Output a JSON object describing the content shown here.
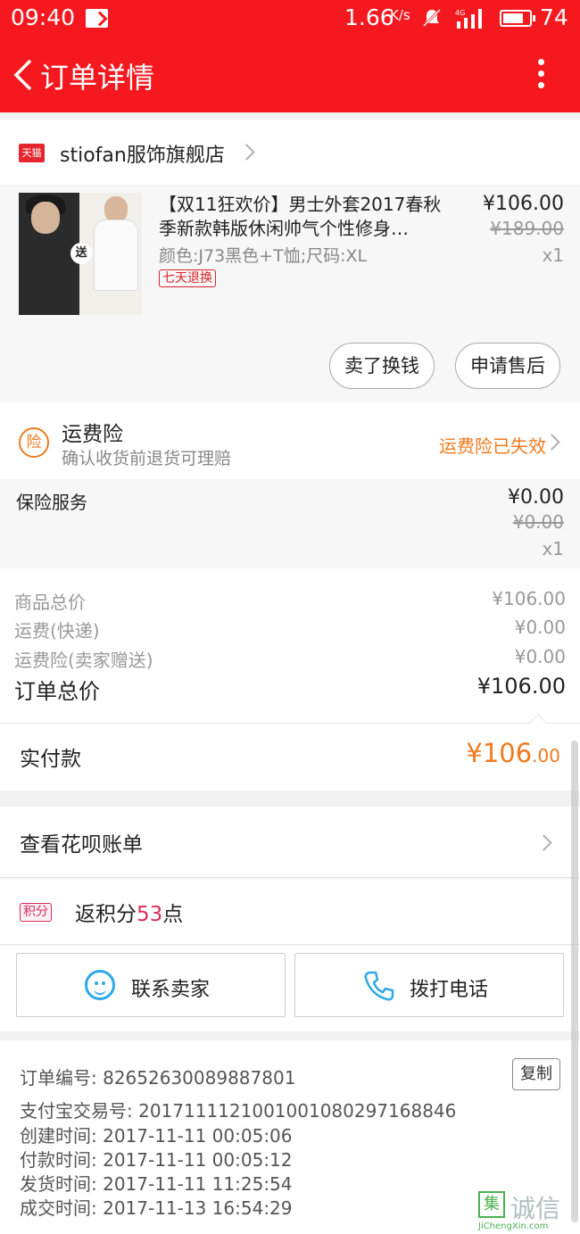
{
  "status_bar": {
    "time": "09:40",
    "net_speed": "1.66",
    "net_unit": "K/s",
    "battery": "74"
  },
  "nav": {
    "title": "订单详情"
  },
  "shop": {
    "badge": "天猫",
    "name": "stiofan服饰旗舰店"
  },
  "item": {
    "title": "【双11狂欢价】男士外套2017春秋季新款韩版休闲帅气个性修身…",
    "sku": "颜色:J73黑色+T恤;尺码:XL",
    "return_badge": "七天退换",
    "price": "¥106.00",
    "orig_price": "¥189.00",
    "qty": "x1",
    "thumb_badge": "送",
    "sell_button": "卖了换钱",
    "after_sale_button": "申请售后"
  },
  "insurance": {
    "icon_char": "险",
    "title": "运费险",
    "subtitle": "确认收货前退货可理赔",
    "status": "运费险已失效"
  },
  "service": {
    "label": "保险服务",
    "price": "¥0.00",
    "orig_price": "¥0.00",
    "qty": "x1"
  },
  "summary": {
    "rows": [
      {
        "label": "商品总价",
        "value": "¥106.00"
      },
      {
        "label": "运费(快递)",
        "value": "¥0.00"
      },
      {
        "label": "运费险(卖家赠送)",
        "value": "¥0.00"
      }
    ],
    "total_label": "订单总价",
    "total_value": "¥106.00"
  },
  "paid": {
    "label": "实付款",
    "amount_main": "¥106",
    "amount_cents": ".00"
  },
  "huabei": {
    "label": "查看花呗账单"
  },
  "points": {
    "badge": "积分",
    "prefix": "返积分",
    "value": "53",
    "suffix": "点"
  },
  "contact": {
    "seller_label": "联系卖家",
    "phone_label": "拨打电话"
  },
  "order_info": {
    "lines": [
      "订单编号: 82652630089887801",
      "支付宝交易号: 2017111121001001080297168846",
      "创建时间: 2017-11-11  00:05:06",
      "付款时间: 2017-11-11  00:05:12",
      "发货时间: 2017-11-11  11:25:54",
      "成交时间: 2017-11-13  16:54:29"
    ],
    "copy_button": "复制"
  },
  "watermark": {
    "box_char": "集",
    "text": "诚信",
    "url": "JiChengXin.com"
  },
  "colors": {
    "brand_red": "#f5191f",
    "accent_orange": "#f07a1e",
    "points_pink": "#d62d5c",
    "wangwang_blue": "#2ea8e6"
  },
  "icons": [
    "back-icon",
    "more-icon",
    "tmall-icon",
    "chevron-right-icon",
    "insurance-icon",
    "wangwang-icon",
    "phone-icon",
    "copy-button"
  ]
}
